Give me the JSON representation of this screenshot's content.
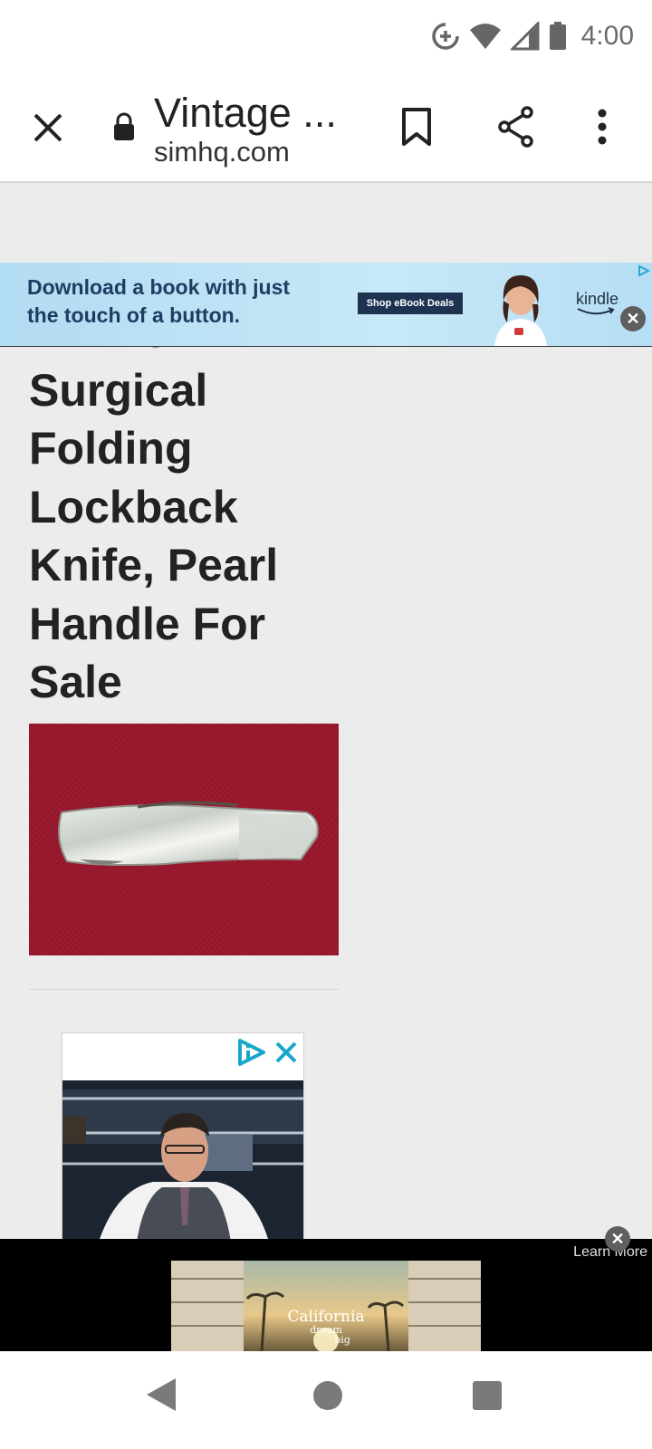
{
  "status_bar": {
    "time": "4:00",
    "icons": [
      "data-saver-icon",
      "wifi-icon",
      "cell-signal-icon",
      "battery-icon"
    ]
  },
  "toolbar": {
    "page_title": "Vintage ...",
    "domain": "simhq.com",
    "icons": [
      "close-icon",
      "lock-icon",
      "bookmark-icon",
      "share-icon",
      "more-vert-icon"
    ]
  },
  "banner_ad": {
    "text_line1": "Download a book with just",
    "text_line2": "the touch of a button.",
    "cta": "Shop eBook Deals",
    "brand": "kindle"
  },
  "article": {
    "title": "Elk Horn Surgical Folding Lockback Knife, Pearl Handle For Sale"
  },
  "bottom_ad": {
    "learn_more": "Learn More",
    "image_text_line1": "California",
    "image_text_line2": "dream",
    "image_text_line3": "big"
  },
  "nav": {
    "icons": [
      "back-icon",
      "home-icon",
      "recents-icon"
    ]
  },
  "colors": {
    "ad_banner": "#bfe4f6",
    "ad_button": "#1d3350",
    "knife_background": "#9a1a2e",
    "title_text": "#222222"
  }
}
